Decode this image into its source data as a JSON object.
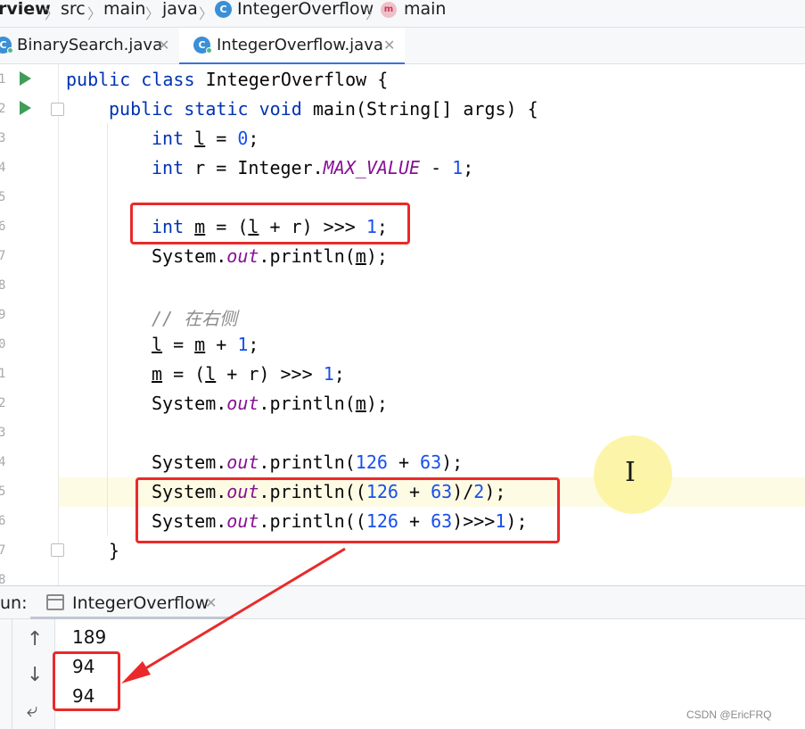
{
  "breadcrumb": {
    "items": [
      "rview",
      "src",
      "main",
      "java",
      "IntegerOverflow",
      "main"
    ],
    "separator": "〉"
  },
  "tabs": [
    {
      "label": "BinarySearch.java",
      "icon": "class-icon",
      "active": false,
      "close": "✕"
    },
    {
      "label": "IntegerOverflow.java",
      "icon": "class-icon",
      "active": true,
      "close": "✕"
    }
  ],
  "editor": {
    "line_numbers": [
      "1",
      "2",
      "3",
      "4",
      "5",
      "6",
      "7",
      "8",
      "9",
      "0",
      "1",
      "2",
      "3",
      "4",
      "5",
      "6",
      "7",
      "8"
    ],
    "code": {
      "l1": {
        "kw1": "public",
        "kw2": "class",
        "rest": "IntegerOverflow {"
      },
      "l2": {
        "kw1": "public",
        "kw2": "static",
        "kw3": "void",
        "rest": "main(String[] args) {"
      },
      "l3": {
        "kw": "int",
        "var": "l",
        "eq": " = ",
        "num": "0",
        "end": ";"
      },
      "l4": {
        "kw": "int",
        "mid": "r = Integer.",
        "fld": "MAX_VALUE",
        "op": " - ",
        "num": "1",
        "end": ";"
      },
      "l6": {
        "kw": "int",
        "var": "m",
        "mid": " = (",
        "var2": "l",
        "mid2": " + r) >>> ",
        "num": "1",
        "end": ";"
      },
      "l7": {
        "pre": "System.",
        "fld": "out",
        "mid": ".println(",
        "var": "m",
        "end": ");"
      },
      "l9": {
        "comment": "// 在右侧"
      },
      "l10": {
        "var": "l",
        "mid": " = ",
        "var2": "m",
        "mid2": " + ",
        "num": "1",
        "end": ";"
      },
      "l11": {
        "var": "m",
        "mid": " = (",
        "var2": "l",
        "mid2": " + r) >>> ",
        "num": "1",
        "end": ";"
      },
      "l12": {
        "pre": "System.",
        "fld": "out",
        "mid": ".println(",
        "var": "m",
        "end": ");"
      },
      "l14": {
        "pre": "System.",
        "fld": "out",
        "mid": ".println(",
        "num1": "126",
        "op": " + ",
        "num2": "63",
        "end": ");"
      },
      "l15": {
        "pre": "System.",
        "fld": "out",
        "mid": ".println((",
        "num1": "126",
        "op": " + ",
        "num2": "63",
        "mid2": ")/",
        "num3": "2",
        "end": ");"
      },
      "l16": {
        "pre": "System.",
        "fld": "out",
        "mid": ".println((",
        "num1": "126",
        "op": " + ",
        "num2": "63",
        "mid2": ")>>>",
        "num3": "1",
        "end": ");"
      },
      "l17": {
        "brace": "}"
      }
    }
  },
  "run_panel": {
    "title": "un:",
    "tab_label": "IntegerOverflow",
    "tab_close": "✕",
    "tools": {
      "up": "↑",
      "down": "↓",
      "wrap": "⤶"
    },
    "output": [
      "189",
      "94",
      "94"
    ]
  },
  "cursor_glyph": "I",
  "watermark": "CSDN @EricFRQ",
  "colors": {
    "keyword": "#0033b3",
    "number": "#1750eb",
    "field": "#871094",
    "comment": "#8c8c8c",
    "annotation_red": "#ea2a2a",
    "run_arrow": "#3f9d57",
    "tab_underline": "#3874d8"
  }
}
